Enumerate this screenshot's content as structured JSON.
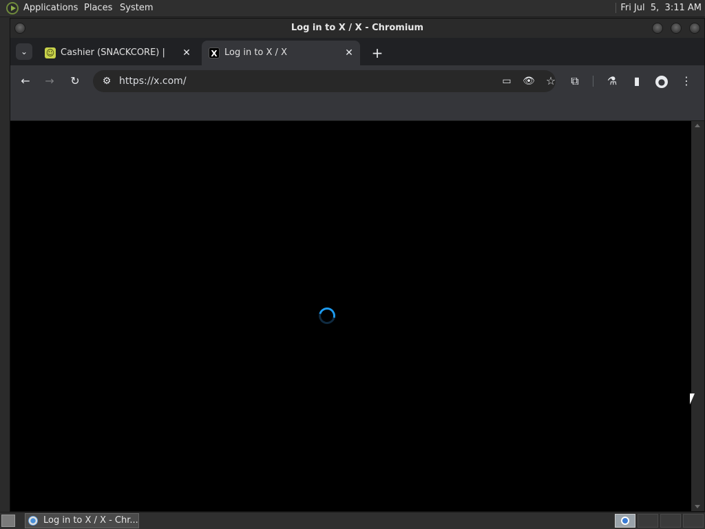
{
  "top_panel": {
    "menus": [
      "Applications",
      "Places",
      "System"
    ],
    "clock": "Fri Jul  5,  3:11 AM"
  },
  "window": {
    "title": "Log in to X / X - Chromium"
  },
  "tabs": [
    {
      "title": "Cashier (SNACKCORE) | Get",
      "favicon": "snackcore-icon",
      "active": false
    },
    {
      "title": "Log in to X / X",
      "favicon": "x-logo-icon",
      "active": true
    }
  ],
  "tab_glyphs": {
    "search": "⌄",
    "close": "✕",
    "new_tab": "+"
  },
  "toolbar": {
    "url": "https://x.com/",
    "icons": {
      "back": "←",
      "forward": "→",
      "reload": "↻",
      "site_info": "⚙",
      "cast": "▭",
      "tracking": "👁",
      "bookmark": "☆",
      "extensions": "⧉",
      "labs": "⚗",
      "side_panel": "▮",
      "profile": "●",
      "menu": "⋮"
    }
  },
  "content": {
    "state": "loading",
    "accent": "#1d9bf0"
  },
  "taskbar": {
    "task_label": "Log in to X / X - Chr..."
  }
}
